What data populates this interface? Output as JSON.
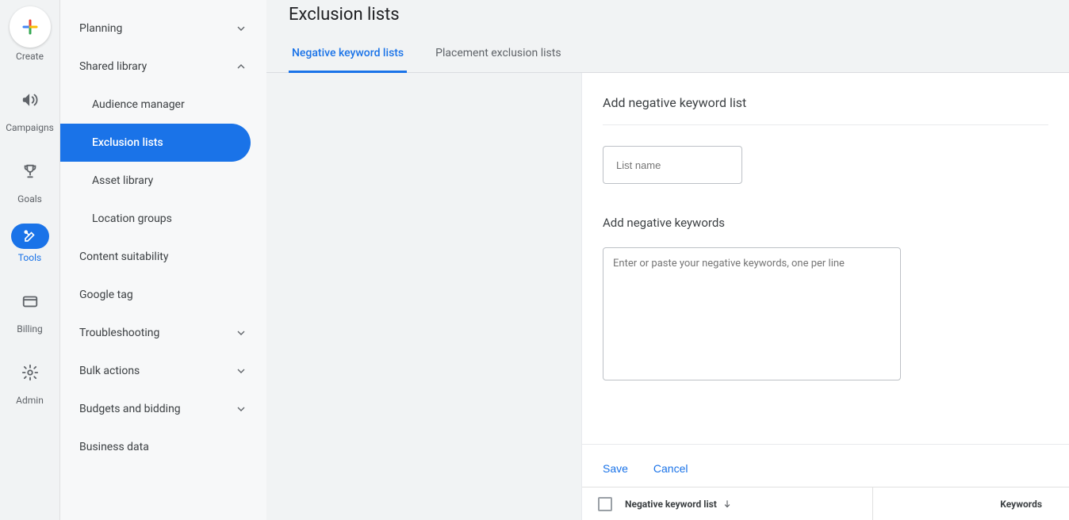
{
  "rail": {
    "create": "Create",
    "campaigns": "Campaigns",
    "goals": "Goals",
    "tools": "Tools",
    "billing": "Billing",
    "admin": "Admin"
  },
  "submenu": {
    "planning": "Planning",
    "shared_library": "Shared library",
    "audience_manager": "Audience manager",
    "exclusion_lists": "Exclusion lists",
    "asset_library": "Asset library",
    "location_groups": "Location groups",
    "content_suitability": "Content suitability",
    "google_tag": "Google tag",
    "troubleshooting": "Troubleshooting",
    "bulk_actions": "Bulk actions",
    "budgets_and_bidding": "Budgets and bidding",
    "business_data": "Business data"
  },
  "page": {
    "title": "Exclusion lists",
    "tabs": {
      "negative": "Negative keyword lists",
      "placement": "Placement exclusion lists"
    }
  },
  "form": {
    "title": "Add negative keyword list",
    "list_name_placeholder": "List name",
    "sub_label": "Add negative keywords",
    "textarea_placeholder": "Enter or paste your negative keywords, one per line",
    "save": "Save",
    "cancel": "Cancel"
  },
  "table": {
    "col1": "Negative keyword list",
    "col2": "Keywords"
  }
}
